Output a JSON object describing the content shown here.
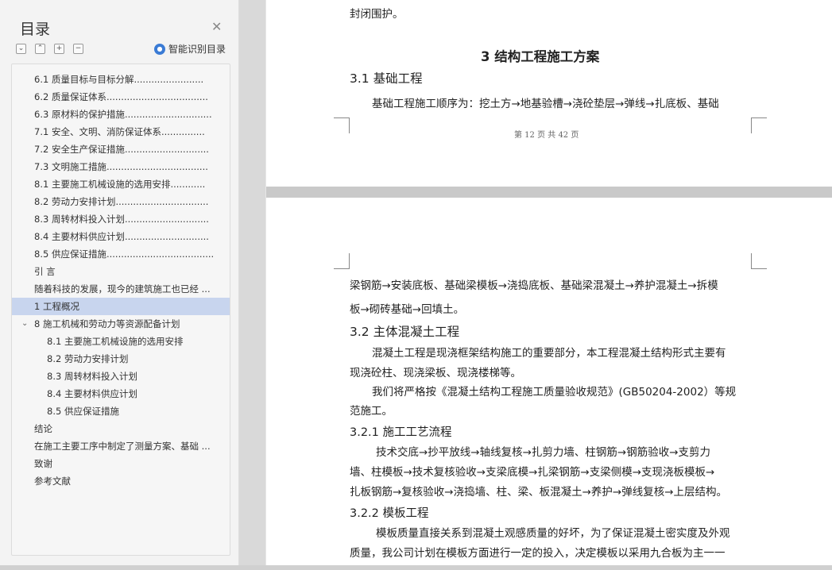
{
  "sidebar": {
    "title": "目录",
    "smart_label": "智能识别目录",
    "items": [
      {
        "text": "6.1  质量目标与目标分解........................",
        "page": "..."
      },
      {
        "text": "6.2  质量保证体系...................................",
        "page": "..."
      },
      {
        "text": "6.3  原材料的保护措施..............................",
        "page": "..."
      },
      {
        "text": "7.1  安全、文明、消防保证体系...............",
        "page": "..."
      },
      {
        "text": "7.2  安全生产保证措施.............................",
        "page": "..."
      },
      {
        "text": "7.3  文明施工措施...................................",
        "page": "..."
      },
      {
        "text": "8.1  主要施工机械设施的选用安排............",
        "page": "..."
      },
      {
        "text": "8.2  劳动力安排计划................................",
        "page": "..."
      },
      {
        "text": "8.3  周转材料投入计划.............................",
        "page": "..."
      },
      {
        "text": "8.4  主要材料供应计划.............................",
        "page": "..."
      },
      {
        "text": "8.5  供应保证措施.....................................",
        "page": "..."
      },
      {
        "text": "引      言",
        "page": ""
      },
      {
        "text": "随着科技的发展，现今的建筑施工也已经 ...",
        "page": ""
      },
      {
        "text": "1   工程概况",
        "page": ""
      },
      {
        "text": "8 施工机械和劳动力等资源配备计划",
        "page": ""
      },
      {
        "text": "8.1 主要施工机械设施的选用安排",
        "page": ""
      },
      {
        "text": "8.2 劳动力安排计划",
        "page": ""
      },
      {
        "text": "8.3 周转材料投入计划",
        "page": ""
      },
      {
        "text": "8.4    主要材料供应计划",
        "page": ""
      },
      {
        "text": "8.5 供应保证措施",
        "page": ""
      },
      {
        "text": "结论",
        "page": ""
      },
      {
        "text": "在施工主要工序中制定了测量方案、基础 ...",
        "page": ""
      },
      {
        "text": "致谢",
        "page": ""
      },
      {
        "text": "参考文献",
        "page": ""
      }
    ]
  },
  "doc": {
    "p1_top": "封闭围护。",
    "p1_h1": "3  结构工程施工方案",
    "p1_h2": "3.1    基础工程",
    "p1_line1": "基础工程施工顺序为：挖土方→地基验槽→浇砼垫层→弹线→扎底板、基础",
    "footer": "第 12 页 共 42 页",
    "p2_l1": "梁钢筋→安装底板、基础梁模板→浇捣底板、基础梁混凝土→养护混凝土→拆模",
    "p2_l2": "板→砌砖基础→回填土。",
    "p2_h2": "3.2    主体混凝土工程",
    "p2_l3": "混凝土工程是现浇框架结构施工的重要部分，本工程混凝土结构形式主要有",
    "p2_l4": "现浇砼柱、现浇梁板、现浇楼梯等。",
    "p2_l5": "我们将严格按《混凝土结构工程施工质量验收规范》(GB50204-2002）等规",
    "p2_l6": "范施工。",
    "p2_h3a": "3.2.1    施工工艺流程",
    "p2_l7": "技术交底→抄平放线→轴线复核→扎剪力墙、柱钢筋→钢筋验收→支剪力",
    "p2_l8": "墙、柱模板→技术复核验收→支梁底模→扎梁钢筋→支梁侧模→支现浇板模板→",
    "p2_l9": "扎板钢筋→复核验收→浇捣墙、柱、梁、板混凝土→养护→弹线复核→上层结构。",
    "p2_h3b": "3.2.2    模板工程",
    "p2_l10": "模板质量直接关系到混凝土观感质量的好坏，为了保证混凝土密实度及外观",
    "p2_l11": "质量，我公司计划在模板方面进行一定的投入，决定模板以采用九合板为主一一"
  }
}
